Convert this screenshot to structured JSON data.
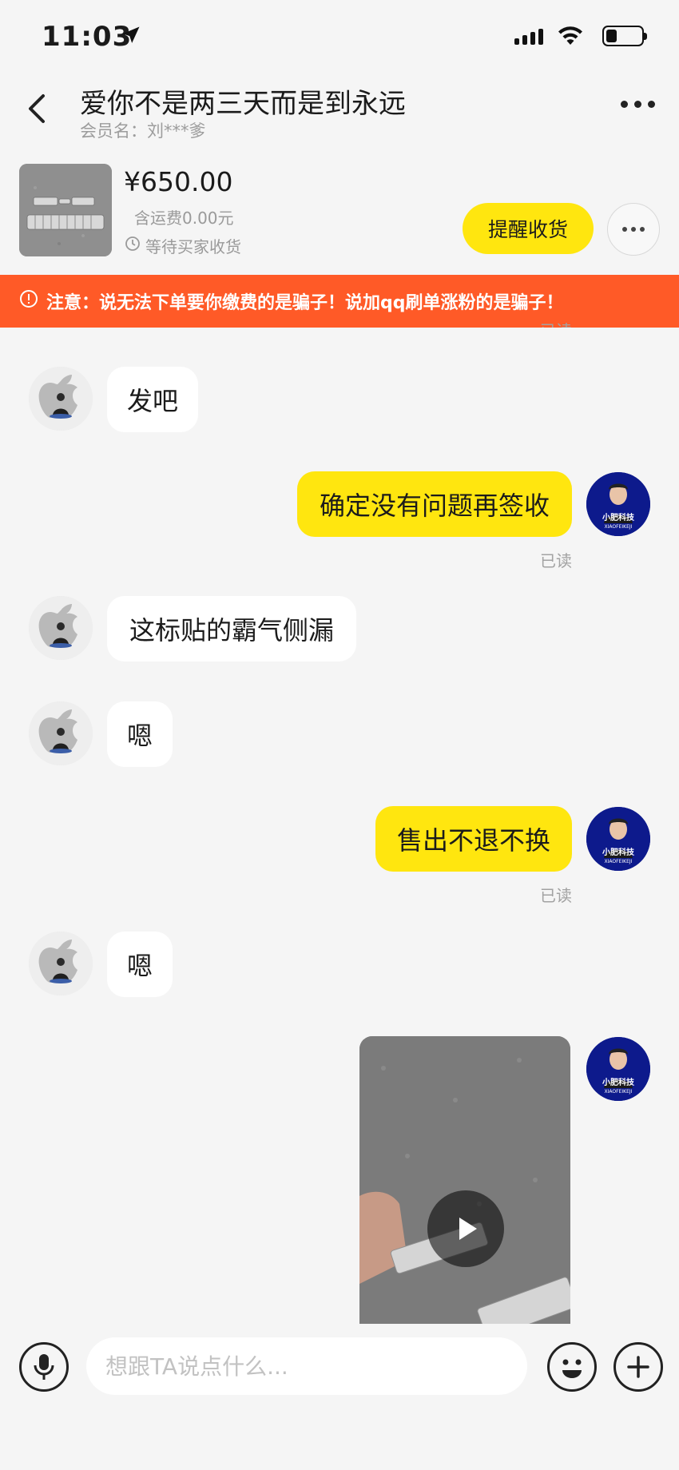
{
  "status_bar": {
    "time": "11:03"
  },
  "header": {
    "title": "爱你不是两三天而是到永远",
    "member_name": "会员名：刘***爹"
  },
  "product": {
    "price": "¥650.00",
    "shipping": "含运费0.00元",
    "status": "等待买家收货",
    "remind_button": "提醒收货"
  },
  "banner": {
    "text": "注意：说无法下单要你缴费的是骗子！说加qq刷单涨粉的是骗子！"
  },
  "messages": [
    {
      "side": "in",
      "text": "发吧"
    },
    {
      "side": "out",
      "text": "确定没有问题再签收",
      "read": "已读"
    },
    {
      "side": "in",
      "text": "这标贴的霸气侧漏"
    },
    {
      "side": "in",
      "text": "嗯"
    },
    {
      "side": "out",
      "text": "售出不退不换",
      "read": "已读"
    },
    {
      "side": "in",
      "text": "嗯"
    },
    {
      "side": "out",
      "type": "video"
    }
  ],
  "top_partial_read": "已读",
  "avatar_label": {
    "line1": "小肥科技",
    "line2": "XIAOFEIKEJI"
  },
  "composer": {
    "placeholder": "想跟TA说点什么..."
  },
  "colors": {
    "accent": "#ffe60f",
    "warning": "#ff5a27"
  }
}
